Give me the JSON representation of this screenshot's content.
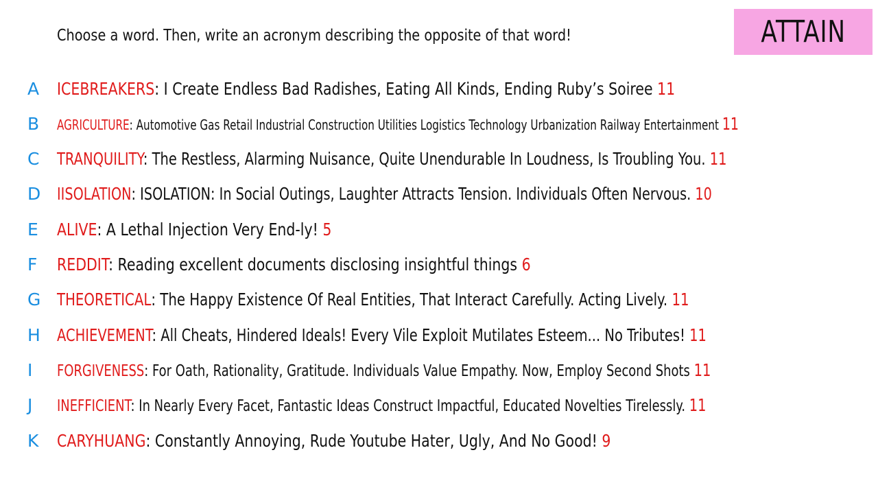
{
  "prompt": "Choose a word. Then, write an acronym describing the opposite of that word!",
  "badge": {
    "word": "ATTAIN",
    "color": "#f7a6e3"
  },
  "colors": {
    "letter": "#1a8ee0",
    "word": "#e01b1b",
    "acronym": "#111111",
    "count": "#e01b1b"
  },
  "entries": [
    {
      "letter": "A",
      "word": "ICEBREAKERS",
      "acronym": "I Create Endless Bad Radishes, Eating All Kinds, Ending Ruby’s Soiree",
      "count": "11"
    },
    {
      "letter": "B",
      "word": "AGRICULTURE",
      "acronym": "Automotive Gas Retail Industrial Construction Utilities Logistics Technology Urbanization Railway Entertainment",
      "count": "11"
    },
    {
      "letter": "C",
      "word": "TRANQUILITY",
      "acronym": "The Restless, Alarming Nuisance, Quite Unendurable In Loudness, Is Troubling You.",
      "count": "11"
    },
    {
      "letter": "D",
      "word": "IISOLATION",
      "acronym": "ISOLATION: In Social Outings, Laughter Attracts Tension. Individuals Often Nervous.",
      "count": "10"
    },
    {
      "letter": "E",
      "word": "ALIVE",
      "acronym": "A Lethal Injection Very End-ly!",
      "count": "5"
    },
    {
      "letter": "F",
      "word": "REDDIT",
      "acronym": "Reading excellent documents disclosing insightful things",
      "count": "6"
    },
    {
      "letter": "G",
      "word": "THEORETICAL",
      "acronym": "The Happy Existence Of Real Entities, That Interact Carefully. Acting Lively.",
      "count": "11"
    },
    {
      "letter": "H",
      "word": "ACHIEVEMENT",
      "acronym": "All Cheats, Hindered Ideals! Every Vile Exploit Mutilates Esteem... No Tributes!",
      "count": "11"
    },
    {
      "letter": "I",
      "word": "FORGIVENESS",
      "acronym": "For Oath, Rationality, Gratitude. Individuals Value Empathy. Now, Employ Second Shots",
      "count": "11"
    },
    {
      "letter": "J",
      "word": "INEFFICIENT",
      "acronym": "In Nearly Every Facet, Fantastic Ideas Construct Impactful, Educated Novelties Tirelessly.",
      "count": "11"
    },
    {
      "letter": "K",
      "word": "CARYHUANG",
      "acronym": "Constantly Annoying, Rude Youtube Hater, Ugly, And No Good!",
      "count": "9"
    }
  ]
}
